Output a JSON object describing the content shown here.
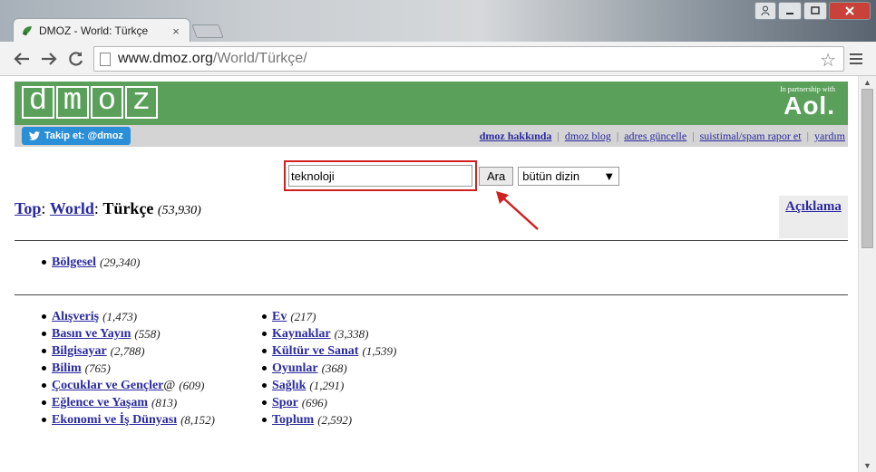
{
  "browser": {
    "tab_title": "DMOZ - World: Türkçe",
    "tab_close": "×",
    "url_host": "www.dmoz.org",
    "url_path": "/World/Türkçe/"
  },
  "header": {
    "logo_letters": [
      "d",
      "m",
      "o",
      "z"
    ],
    "partner_small": "In partnership with",
    "partner_brand": "Aol.",
    "follow_label": "Takip et: @dmoz",
    "links": [
      {
        "label": "dmoz hakkında",
        "bold": true
      },
      {
        "label": "dmoz blog"
      },
      {
        "label": "adres güncelle"
      },
      {
        "label": "suistimal/spam rapor et"
      },
      {
        "label": "yardım"
      }
    ]
  },
  "search": {
    "value": "teknoloji",
    "button_label": "Ara",
    "scope_value": "bütün dizin"
  },
  "breadcrumb": {
    "top": "Top",
    "world": "World",
    "current": "Türkçe",
    "count": "(53,930)"
  },
  "description_link": "Açıklama",
  "regional": [
    {
      "label": "Bölgesel",
      "count": "(29,340)"
    }
  ],
  "categories_col1": [
    {
      "label": "Alışveriş",
      "count": "(1,473)"
    },
    {
      "label": "Basın ve Yayın",
      "count": "(558)"
    },
    {
      "label": "Bilgisayar",
      "count": "(2,788)"
    },
    {
      "label": "Bilim",
      "count": "(765)"
    },
    {
      "label": "Çocuklar ve Gençler",
      "suffix": "@",
      "count": "(609)"
    },
    {
      "label": "Eğlence ve Yaşam",
      "count": "(813)"
    },
    {
      "label": "Ekonomi ve İş Dünyası",
      "count": "(8,152)"
    }
  ],
  "categories_col2": [
    {
      "label": "Ev",
      "count": "(217)"
    },
    {
      "label": "Kaynaklar",
      "count": "(3,338)"
    },
    {
      "label": "Kültür ve Sanat",
      "count": "(1,539)"
    },
    {
      "label": "Oyunlar",
      "count": "(368)"
    },
    {
      "label": "Sağlık",
      "count": "(1,291)"
    },
    {
      "label": "Spor",
      "count": "(696)"
    },
    {
      "label": "Toplum",
      "count": "(2,592)"
    }
  ],
  "colors": {
    "header_green": "#5aa05a",
    "link_blue": "#2a2aa0",
    "highlight_red": "#d21f1f",
    "twitter_blue": "#2b8fd8"
  }
}
